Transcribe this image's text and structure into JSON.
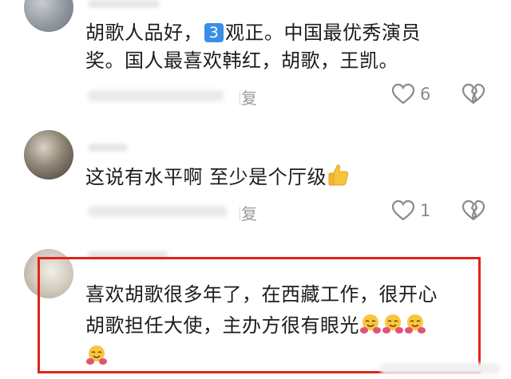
{
  "comments": [
    {
      "segments": [
        "胡歌人品好，",
        "3",
        "观正。中国最优秀演员",
        "奖。国人最喜欢韩红，胡歌，王凯。"
      ],
      "reply_label": "回复",
      "like_count": "6"
    },
    {
      "text": "这说有水平啊 至少是个厅级",
      "reply_label": "回复",
      "like_count": "1"
    },
    {
      "line1": "喜欢胡歌很多年了，在西藏工作，很开心",
      "line2": "胡歌担任大使，主办方很有眼光"
    }
  ],
  "icons": {
    "like": "heart-outline-icon",
    "dislike": "broken-heart-icon",
    "thumbs_up": "thumbs-up-emoji",
    "hugging": "hugging-face-emoji",
    "keycap": "keycap-3-emoji"
  },
  "colors": {
    "highlight_border": "#e2231a",
    "keycap_bg": "#3a8ee6"
  }
}
